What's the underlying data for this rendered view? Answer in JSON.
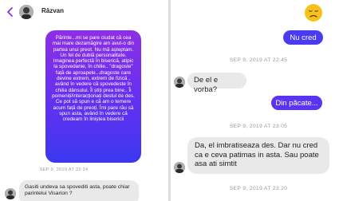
{
  "left": {
    "contact_name": "Răzvan",
    "sent_long": "Părinte...mi se pare ciudat că cea mai mare dezamăgire am avut-o din partea unui preot. Nu mă așteptam. Un fel de dublă personalitate. Imaginea perfectă în biserică, atipic la spovedanie, în chilie.. \"dragoste\" față  de aproapele...dragoste care devine extrem, extrem de fizică , având în vedere că spovedeste în chilia dânsului. Îi știți prea bine.. Îi pomeniți/interacționați destul de des. Ce pot să spun e că am o temere acum față de preoți. Îmi pare rău să spun asta, având în vedere că credeam în liniștea bisericii",
    "timestamp": "SEP 9, 2019 AT 22:24",
    "received": "Gasiti undeva sa spovediti asta, poate chiar parintelui Visarion ?"
  },
  "right": {
    "emoji": "disappointed-face",
    "msg_nu_cred": "Nu cred",
    "timestamp_1": "SEP 9, 2019 AT 22:45",
    "msg_de_el": "De el e vorba?",
    "msg_din_pacate": "Din păcate...",
    "timestamp_2": "SEP 9, 2019 AT 23:05",
    "msg_da": "Da, el imbratiseaza des. Dar nu cred ca e ceva patimas in asta. Sau poate asa ati simtit",
    "timestamp_3": "SEP 9, 2019 AT 23:20"
  },
  "colors": {
    "sent_top": "#8d2fe4",
    "sent_bottom": "#3c38f0",
    "sent_blue": "#4a3af1",
    "received_bg": "#e9e9e9",
    "timestamp": "#9b9b9b"
  }
}
